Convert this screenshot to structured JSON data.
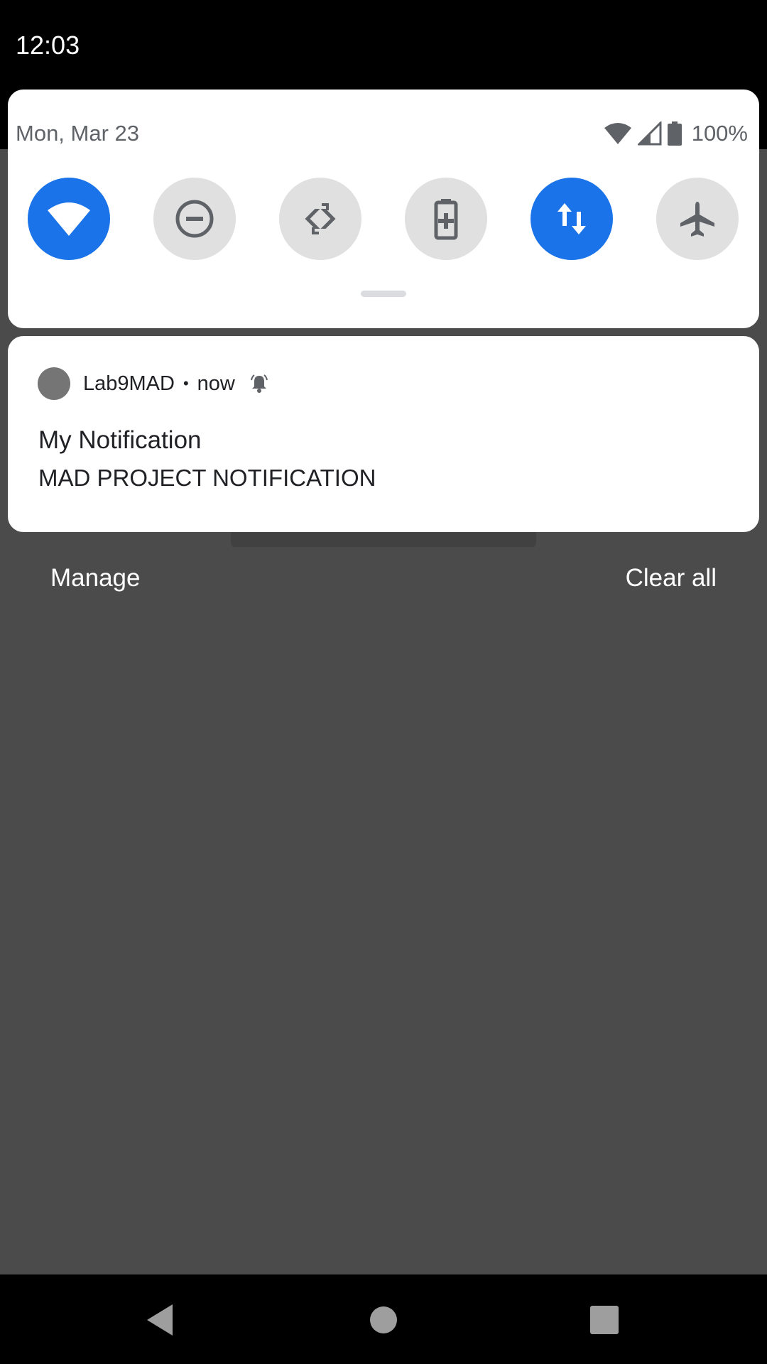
{
  "status_bar": {
    "time": "12:03"
  },
  "quick_settings": {
    "date": "Mon, Mar 23",
    "battery_percent": "100%",
    "tiles": [
      {
        "icon": "wifi-icon",
        "active": true
      },
      {
        "icon": "do-not-disturb-icon",
        "active": false
      },
      {
        "icon": "auto-rotate-icon",
        "active": false
      },
      {
        "icon": "battery-saver-icon",
        "active": false
      },
      {
        "icon": "mobile-data-icon",
        "active": true
      },
      {
        "icon": "airplane-mode-icon",
        "active": false
      }
    ],
    "accent_color": "#1a73e8"
  },
  "background_text": "MAD PROJECT NOTIFICATION",
  "notification": {
    "app_name": "Lab9MAD",
    "separator": "•",
    "time": "now",
    "title": "My Notification",
    "text": "MAD PROJECT NOTIFICATION"
  },
  "actions": {
    "manage_label": "Manage",
    "clear_all_label": "Clear all"
  },
  "navigation": {
    "buttons": [
      "back-icon",
      "home-icon",
      "recents-icon"
    ]
  }
}
